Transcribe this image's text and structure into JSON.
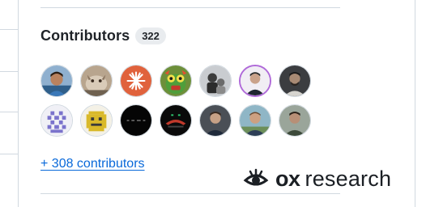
{
  "contributors": {
    "title": "Contributors",
    "count": "322",
    "more_link": "+ 308 contributors",
    "avatars": [
      {
        "icon": "contributor-avatar-1"
      },
      {
        "icon": "contributor-avatar-2"
      },
      {
        "icon": "contributor-avatar-3"
      },
      {
        "icon": "contributor-avatar-4"
      },
      {
        "icon": "contributor-avatar-5"
      },
      {
        "icon": "contributor-avatar-6"
      },
      {
        "icon": "contributor-avatar-7"
      },
      {
        "icon": "contributor-avatar-8"
      },
      {
        "icon": "contributor-avatar-9"
      },
      {
        "icon": "contributor-avatar-10"
      },
      {
        "icon": "contributor-avatar-11"
      },
      {
        "icon": "contributor-avatar-12"
      },
      {
        "icon": "contributor-avatar-13"
      },
      {
        "icon": "contributor-avatar-14"
      }
    ]
  },
  "watermark": {
    "brand_bold": "ox",
    "brand_light": "research",
    "icon": "eye-icon"
  },
  "colors": {
    "link": "#0969da",
    "text": "#1f2328",
    "badge_bg": "#e9ecef",
    "divider": "#d1d9e0"
  }
}
